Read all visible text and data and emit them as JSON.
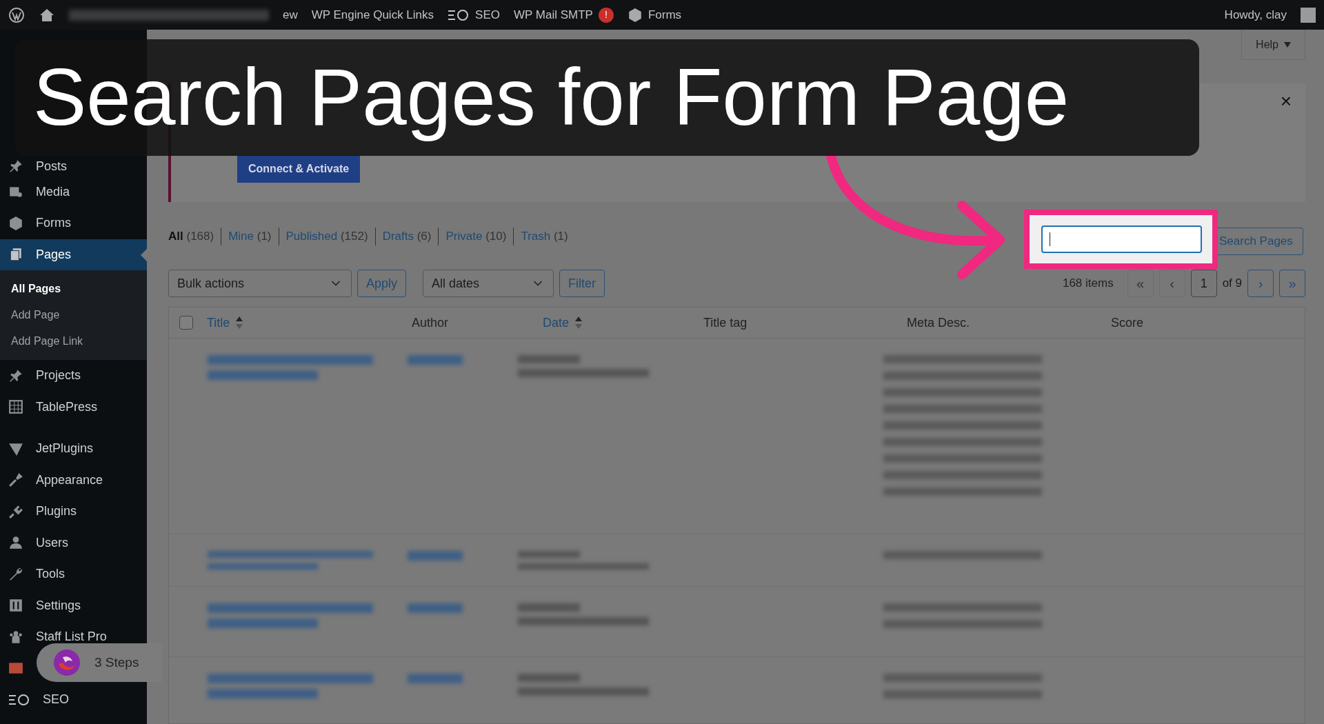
{
  "admin_bar": {
    "items": [
      {
        "label": "ew",
        "kind": "text"
      },
      {
        "label": "WP Engine Quick Links",
        "kind": "text"
      },
      {
        "label": "SEO",
        "kind": "seo"
      },
      {
        "label": "WP Mail SMTP",
        "kind": "alert",
        "badge": "!"
      },
      {
        "label": "Forms",
        "kind": "forms"
      }
    ],
    "greeting": "Howdy, clay"
  },
  "sidebar": {
    "items": [
      {
        "label": "Posts",
        "selected": false
      },
      {
        "label": "Media",
        "selected": false
      },
      {
        "label": "Forms",
        "selected": false
      },
      {
        "label": "Pages",
        "selected": true,
        "children": [
          {
            "label": "All Pages",
            "selected": true
          },
          {
            "label": "Add Page",
            "selected": false
          },
          {
            "label": "Add Page Link",
            "selected": false
          }
        ]
      },
      {
        "label": "Projects",
        "selected": false
      },
      {
        "label": "TablePress",
        "selected": false
      },
      {
        "label": "JetPlugins",
        "selected": false
      },
      {
        "label": "Appearance",
        "selected": false
      },
      {
        "label": "Plugins",
        "selected": false
      },
      {
        "label": "Users",
        "selected": false
      },
      {
        "label": "Tools",
        "selected": false
      },
      {
        "label": "Settings",
        "selected": false
      },
      {
        "label": "Staff List Pro",
        "selected": false
      },
      {
        "selected": false
      },
      {
        "label": "SEO",
        "selected": false
      }
    ]
  },
  "header": {
    "help": "Help"
  },
  "notice": {
    "button": "Connect & Activate",
    "close": "×"
  },
  "filters": [
    {
      "label": "All",
      "count": "(168)",
      "selected": true
    },
    {
      "label": "Mine",
      "count": "(1)",
      "selected": false
    },
    {
      "label": "Published",
      "count": "(152)",
      "selected": false
    },
    {
      "label": "Drafts",
      "count": "(6)",
      "selected": false
    },
    {
      "label": "Private",
      "count": "(10)",
      "selected": false
    },
    {
      "label": "Trash",
      "count": "(1)",
      "selected": false
    }
  ],
  "search": {
    "button": "Search Pages"
  },
  "toolbar": {
    "bulk": "Bulk actions",
    "apply": "Apply",
    "dates": "All dates",
    "filter": "Filter"
  },
  "pagination": {
    "count": "168 items",
    "first": "«",
    "prev": "‹",
    "page": "1",
    "of": "of 9",
    "next": "›",
    "last": "»"
  },
  "table": {
    "select_all": {
      "checked": false
    },
    "columns": [
      {
        "label": "Title",
        "sortable": true
      },
      {
        "label": "Author",
        "sortable": false
      },
      {
        "label": "Date",
        "sortable": true
      },
      {
        "label": "Title tag",
        "sortable": false
      },
      {
        "label": "Meta Desc.",
        "sortable": false
      },
      {
        "label": "Score",
        "sortable": false
      }
    ]
  },
  "caption": "Search Pages for Form Page",
  "guide": {
    "steps": "3 Steps"
  }
}
